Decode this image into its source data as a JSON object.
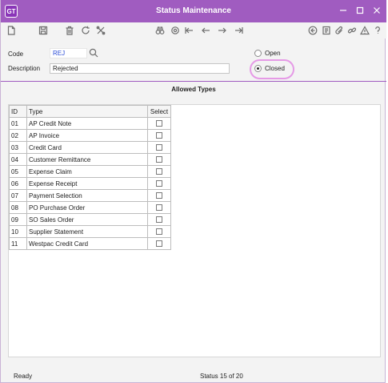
{
  "window": {
    "logo": "GT",
    "title": "Status Maintenance",
    "controls": [
      "minimize-icon",
      "maximize-icon",
      "close-icon"
    ]
  },
  "toolbar": {
    "left_icons": [
      "new-icon",
      "save-icon",
      "delete-icon",
      "refresh-icon",
      "tools-icon"
    ],
    "nav_icons": [
      "binoculars-icon",
      "search-icon",
      "first-icon",
      "previous-icon",
      "next-icon",
      "last-icon"
    ],
    "right_icons": [
      "back-icon",
      "report-icon",
      "attach-icon",
      "link-icon",
      "warning-icon",
      "help-icon"
    ]
  },
  "form": {
    "code_label": "Code",
    "code_value": "REJ",
    "description_label": "Description",
    "description_value": "Rejected",
    "open_label": "Open",
    "closed_label": "Closed",
    "selected_state": "Closed"
  },
  "allowed_types": {
    "title": "Allowed Types",
    "columns": [
      "ID",
      "Type",
      "Select"
    ],
    "rows": [
      {
        "id": "01",
        "type": "AP Credit Note",
        "select": false
      },
      {
        "id": "02",
        "type": "AP Invoice",
        "select": false
      },
      {
        "id": "03",
        "type": "Credit Card",
        "select": false
      },
      {
        "id": "04",
        "type": "Customer Remittance",
        "select": false
      },
      {
        "id": "05",
        "type": "Expense Claim",
        "select": false
      },
      {
        "id": "06",
        "type": "Expense Receipt",
        "select": false
      },
      {
        "id": "07",
        "type": "Payment Selection",
        "select": false
      },
      {
        "id": "08",
        "type": "PO Purchase Order",
        "select": false
      },
      {
        "id": "09",
        "type": "SO Sales Order",
        "select": false
      },
      {
        "id": "10",
        "type": "Supplier Statement",
        "select": false
      },
      {
        "id": "11",
        "type": "Westpac Credit Card",
        "select": false
      }
    ]
  },
  "statusbar": {
    "left": "Ready",
    "center": "Status 15 of 20"
  },
  "colors": {
    "title_bar": "#a05cc0",
    "highlight_circle": "#e59ae6",
    "code_text": "#2a4cd7"
  }
}
